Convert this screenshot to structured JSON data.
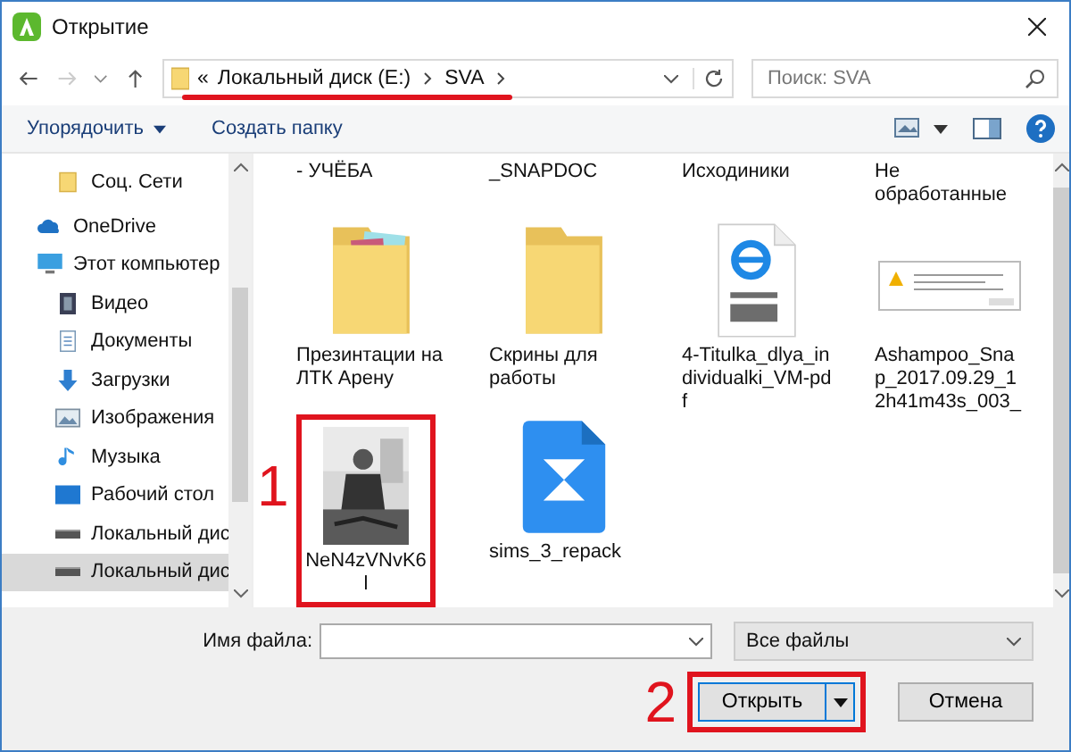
{
  "window": {
    "title": "Открытие"
  },
  "address": {
    "overflow": "«",
    "path": [
      {
        "label": "Локальный диск (E:)"
      },
      {
        "label": "SVA"
      }
    ],
    "underlined": true
  },
  "search": {
    "placeholder": "Поиск: SVA"
  },
  "toolbar": {
    "organize": "Упорядочить",
    "new_folder": "Создать папку"
  },
  "sidebar": {
    "items": [
      {
        "label": "Соц. Сети",
        "kind": "folder",
        "selected": false
      },
      {
        "label": "OneDrive",
        "kind": "cloud",
        "selected": false
      },
      {
        "label": "Этот компьютер",
        "kind": "computer",
        "selected": false,
        "children": [
          {
            "label": "Видео",
            "kind": "video",
            "selected": false
          },
          {
            "label": "Документы",
            "kind": "docs",
            "selected": false
          },
          {
            "label": "Загрузки",
            "kind": "download",
            "selected": false
          },
          {
            "label": "Изображения",
            "kind": "images",
            "selected": false
          },
          {
            "label": "Музыка",
            "kind": "music",
            "selected": false
          },
          {
            "label": "Рабочий стол",
            "kind": "desktop",
            "selected": false
          },
          {
            "label": "Локальный дис",
            "kind": "drive",
            "selected": false
          },
          {
            "label": "Локальный дис",
            "kind": "drive",
            "selected": true
          }
        ]
      }
    ]
  },
  "files": [
    {
      "label": "- УЧЁБА",
      "kind": "hidden"
    },
    {
      "label": "_SNAPDOC",
      "kind": "hidden"
    },
    {
      "label": "Исходиники",
      "kind": "hidden"
    },
    {
      "label": "Не обработанные",
      "kind": "hidden"
    },
    {
      "label": "Презинтации на ЛТК Арену",
      "kind": "folder-docs"
    },
    {
      "label": "Скрины для работы",
      "kind": "folder"
    },
    {
      "label": "4-Titulka_dlya_individualki_VM-pdf",
      "kind": "pdf"
    },
    {
      "label": "Ashampoo_Snap_2017.09.29_12h41m43s_003_",
      "kind": "screenshot"
    },
    {
      "label": "NeN4zVNvK6l",
      "marker": "1"
    },
    {
      "label": "sims_3_repack",
      "kind": "app"
    }
  ],
  "bottom": {
    "filename_label": "Имя файла:",
    "filetype": "Все файлы",
    "open": "Открыть",
    "open_marker": "2",
    "cancel": "Отмена"
  }
}
